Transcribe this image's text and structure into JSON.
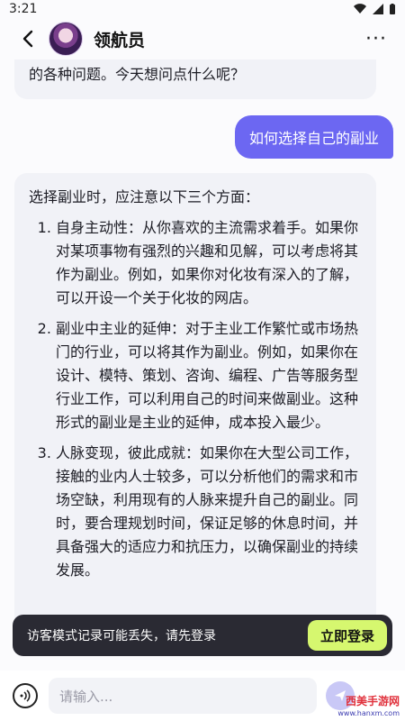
{
  "status": {
    "time": "3:21"
  },
  "header": {
    "title": "领航员",
    "more_label": "···"
  },
  "messages": {
    "top_fragment": "的各种问题。今天想问点什么呢？",
    "user": "如何选择自己的副业",
    "bot_intro": "选择副业时，应注意以下三个方面：",
    "bot_points": [
      "自身主动性：从你喜欢的主流需求着手。如果你对某项事物有强烈的兴趣和见解，可以考虑将其作为副业。例如，如果你对化妆有深入的了解，可以开设一个关于化妆的网店。",
      "副业中主业的延伸：对于主业工作繁忙或市场热门的行业，可以将其作为副业。例如，如果你在设计、模特、策划、咨询、编程、广告等服务型行业工作，可以利用自己的时间来做副业。这种形式的副业是主业的延伸，成本投入最少。",
      "人脉变现，彼此成就：如果你在大型公司工作，接触的业内人士较多，可以分析他们的需求和市场空缺，利用现有的人脉来提升自己的副业。同时，要合理规划时间，保证足够的休息时间，并具备强大的适应力和抗压力，以确保副业的持续发展。"
    ]
  },
  "guest_banner": {
    "text": "访客模式记录可能丢失，请先登录",
    "button": "立即登录"
  },
  "input": {
    "placeholder": "请输入..."
  },
  "watermark": {
    "brand": "西美手游网",
    "url": "www.hanxm.com"
  },
  "colors": {
    "accent": "#6c67f2",
    "login": "#d6f76f",
    "banner": "#2a2a33"
  }
}
